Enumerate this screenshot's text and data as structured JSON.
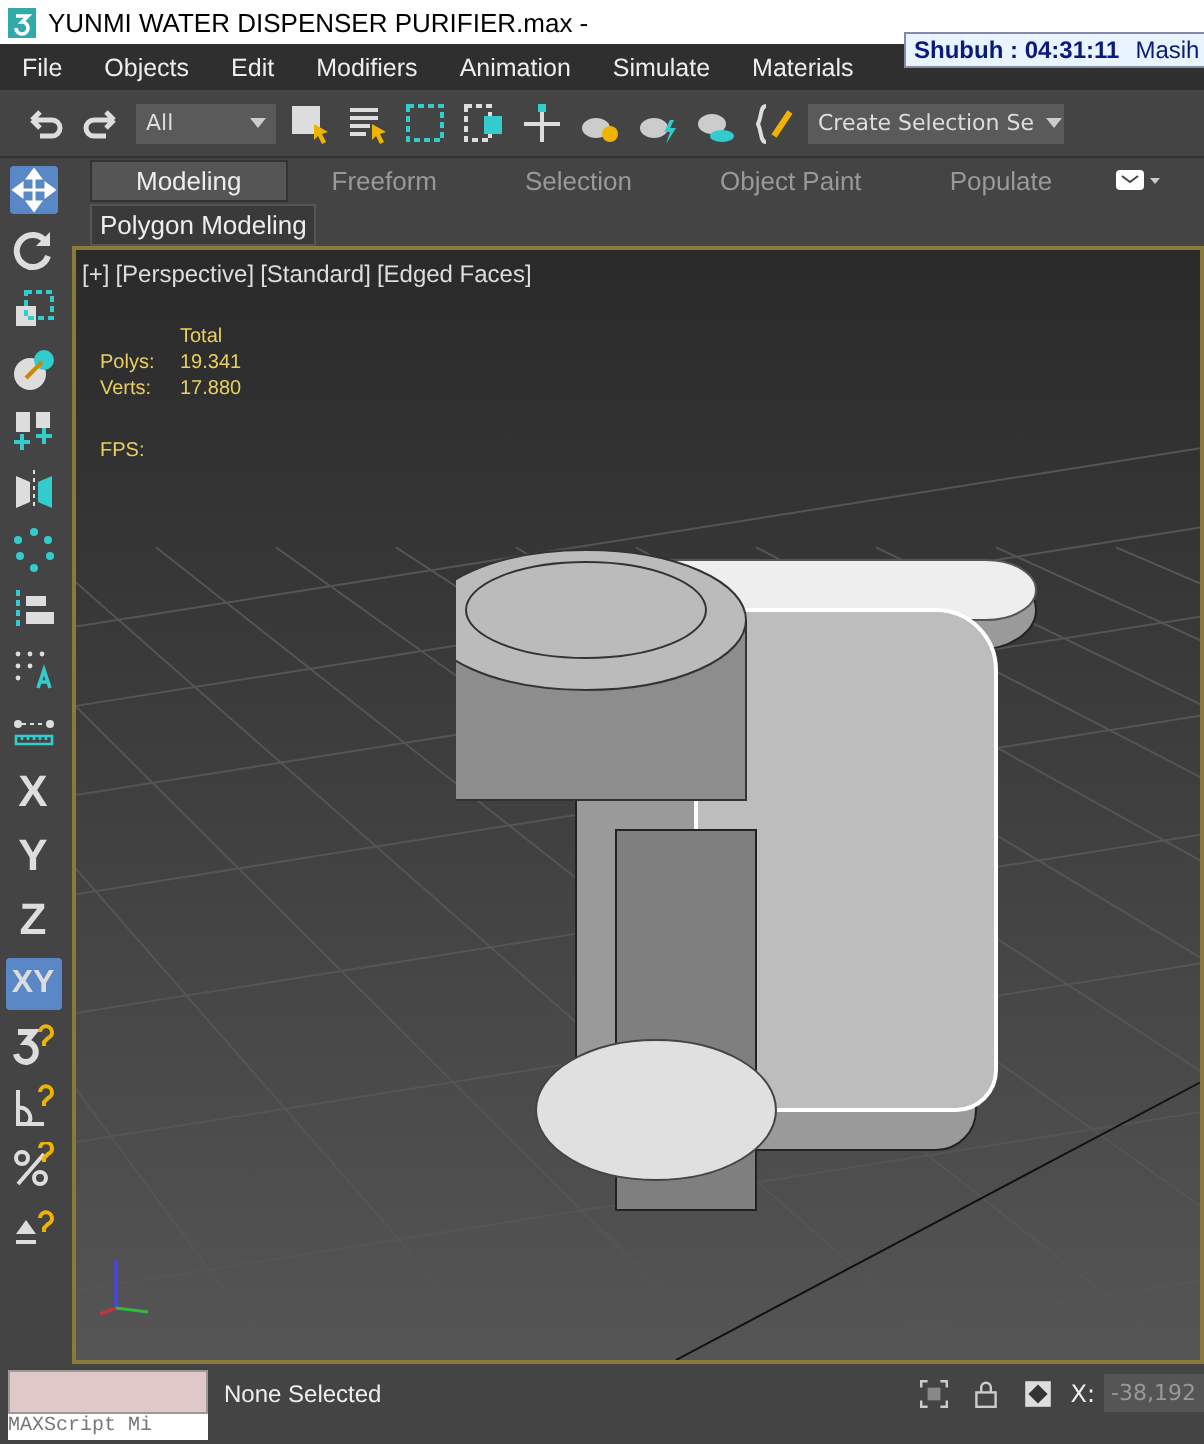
{
  "window": {
    "title": "YUNMI WATER DISPENSER PURIFIER.max -"
  },
  "clock_overlay": {
    "time": "Shubuh : 04:31:11",
    "note": "Masih"
  },
  "menu": [
    "File",
    "Objects",
    "Edit",
    "Modifiers",
    "Animation",
    "Simulate",
    "Materials"
  ],
  "toolbar": {
    "selection_filter": "All",
    "named_selection": "Create Selection Se"
  },
  "ribbon": {
    "tabs": [
      {
        "label": "Modeling",
        "selected": true
      },
      {
        "label": "Freeform",
        "selected": false
      },
      {
        "label": "Selection",
        "selected": false
      },
      {
        "label": "Object Paint",
        "selected": false
      },
      {
        "label": "Populate",
        "selected": false
      }
    ],
    "panel": "Polygon Modeling"
  },
  "axis_constraints": [
    {
      "label": "X",
      "selected": false
    },
    {
      "label": "Y",
      "selected": false
    },
    {
      "label": "Z",
      "selected": false
    },
    {
      "label": "XY",
      "selected": true
    }
  ],
  "viewport": {
    "labels": [
      "[+]",
      "[Perspective]",
      "[Standard]",
      "[Edged Faces]"
    ],
    "stats_header": "Total",
    "stats": [
      {
        "label": "Polys:",
        "value": "19.341"
      },
      {
        "label": "Verts:",
        "value": "17.880"
      }
    ],
    "fps_label": "FPS:"
  },
  "status_bar": {
    "maxscript": "MAXScript Mi",
    "selection": "None Selected",
    "x_label": "X:",
    "x_value": "-38,192"
  }
}
